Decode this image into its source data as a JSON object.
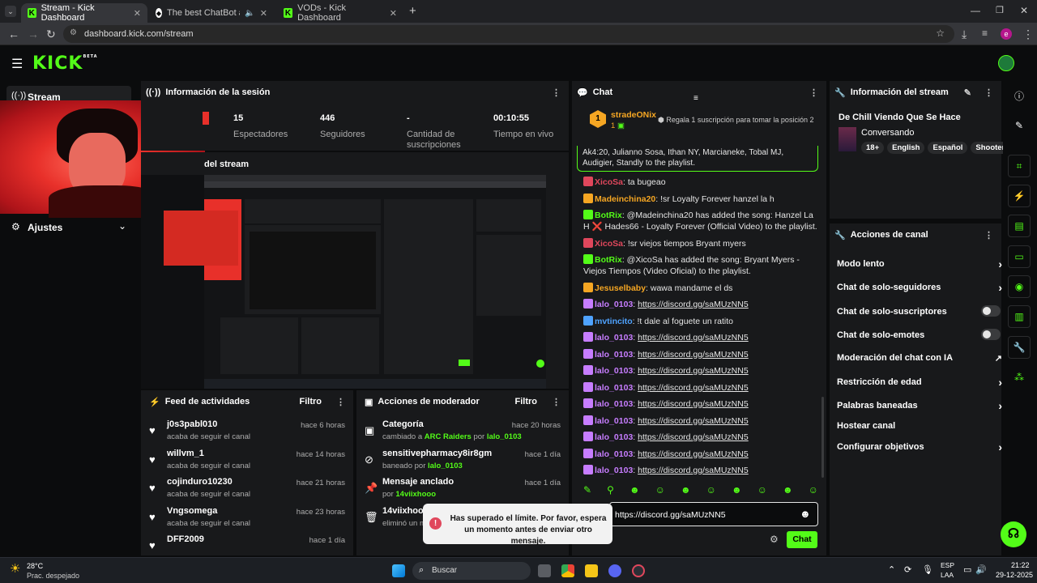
{
  "browser": {
    "tabs": [
      {
        "label": "Stream - Kick Dashboard"
      },
      {
        "label": "The best ChatBot and Widg"
      },
      {
        "label": "VODs - Kick Dashboard"
      }
    ],
    "url": "dashboard.kick.com/stream"
  },
  "header": {
    "logo": "KICK",
    "logo_sup": "BETA"
  },
  "sidebar": {
    "stream_label": "Stream",
    "settings_label": "Ajustes"
  },
  "session": {
    "title": "Información de la sesión",
    "stats": [
      {
        "value": "15",
        "label": "Espectadores"
      },
      {
        "value": "446",
        "label": "Seguidores"
      },
      {
        "value": "-",
        "label": "Cantidad de suscripciones"
      },
      {
        "value": "00:10:55",
        "label": "Tiempo en vivo"
      }
    ]
  },
  "preview": {
    "title": "del stream"
  },
  "activity": {
    "title": "Feed de actividades",
    "filter": "Filtro",
    "items": [
      {
        "name": "j0s3pabl010",
        "sub": "acaba de seguir el canal",
        "time": "hace 6 horas"
      },
      {
        "name": "willvm_1",
        "sub": "acaba de seguir el canal",
        "time": "hace 14 horas"
      },
      {
        "name": "cojinduro10230",
        "sub": "acaba de seguir el canal",
        "time": "hace 21 horas"
      },
      {
        "name": "Vngsomega",
        "sub": "acaba de seguir el canal",
        "time": "hace 23 horas"
      },
      {
        "name": "DFF2009",
        "sub": "",
        "time": "hace 1 día"
      }
    ]
  },
  "mod": {
    "title": "Acciones de moderador",
    "filter": "Filtro",
    "items": [
      {
        "name": "Categoría",
        "sub_pre": "cambiado a ",
        "sub_hl": "ARC Raiders",
        "sub_mid": " por ",
        "sub_user": "lalo_0103",
        "time": "hace 20 horas"
      },
      {
        "name": "sensitivepharmacy8ir8gm",
        "sub_pre": "baneado por ",
        "sub_user": "lalo_0103",
        "time": "hace 1 día"
      },
      {
        "name": "Mensaje anclado",
        "sub_pre": "por ",
        "sub_user": "14viixhooo",
        "time": "hace 1 día"
      },
      {
        "name": "14viixhooo",
        "sub_pre": "eliminó un m",
        "time": ""
      }
    ]
  },
  "toast": {
    "text": "Has superado el límite. Por favor, espera un momento antes de enviar otro mensaje."
  },
  "chat": {
    "title": "Chat",
    "top_user": "stradeONix",
    "top_rank": "1",
    "top_count": "1",
    "top_note": "Regala 1 suscripción para tomar la posición 2",
    "pinned": "Ak4:20, Julianno Sosa, Ithan NY, Marcianeke, Tobal MJ, Audigier, Standly to the playlist.",
    "messages": [
      {
        "user": "XicoSa",
        "color": "#e0475c",
        "text": ": ta bugeao"
      },
      {
        "user": "Madeinchina20",
        "color": "#f5a623",
        "text": ": !sr Loyalty Forever hanzel la h"
      },
      {
        "user": "BotRix",
        "color": "#53fc18",
        "text": ": @Madeinchina20 has added the song: Hanzel La H ❌ Hades66 - Loyalty Forever (Official Video) to the playlist."
      },
      {
        "user": "XicoSa",
        "color": "#e0475c",
        "text": ": !sr viejos tiempos Bryant myers"
      },
      {
        "user": "BotRix",
        "color": "#53fc18",
        "text": ": @XicoSa has added the song: Bryant Myers - Viejos Tiempos (Video Oficial) to the playlist."
      },
      {
        "user": "Jesuselbaby",
        "color": "#f5a623",
        "text": ": wawa mandame el ds"
      },
      {
        "user": "lalo_0103",
        "color": "#c77dff",
        "link": "https://discord.gg/saMUzNN5"
      },
      {
        "user": "mvtincito",
        "color": "#4fa3ff",
        "text": ": !t dale al foguete un ratito"
      },
      {
        "user": "lalo_0103",
        "color": "#c77dff",
        "link": "https://discord.gg/saMUzNN5"
      },
      {
        "user": "lalo_0103",
        "color": "#c77dff",
        "link": "https://discord.gg/saMUzNN5"
      },
      {
        "user": "lalo_0103",
        "color": "#c77dff",
        "link": "https://discord.gg/saMUzNN5"
      },
      {
        "user": "lalo_0103",
        "color": "#c77dff",
        "link": "https://discord.gg/saMUzNN5"
      },
      {
        "user": "lalo_0103",
        "color": "#c77dff",
        "link": "https://discord.gg/saMUzNN5"
      },
      {
        "user": "lalo_0103",
        "color": "#c77dff",
        "link": "https://discord.gg/saMUzNN5"
      },
      {
        "user": "lalo_0103",
        "color": "#c77dff",
        "link": "https://discord.gg/saMUzNN5"
      },
      {
        "user": "lalo_0103",
        "color": "#c77dff",
        "link": "https://discord.gg/saMUzNN5"
      },
      {
        "user": "lalo_0103",
        "color": "#c77dff",
        "link": "https://discord.gg/saMUzNN5"
      },
      {
        "user": "lalo_0103",
        "color": "#c77dff",
        "link": "https://discord.gg/saMUzNN5"
      }
    ],
    "input_value": "https://discord.gg/saMUzNN5",
    "send_label": "Chat"
  },
  "stream_info": {
    "title": "Información del stream",
    "stream_title": "De Chill Viendo Que Se Hace",
    "category": "Conversando",
    "tags": [
      "18+",
      "English",
      "Español",
      "Shooter"
    ]
  },
  "channel_actions": {
    "title": "Acciones de canal",
    "items": [
      {
        "label": "Modo lento",
        "kind": "chevron"
      },
      {
        "label": "Chat de solo-seguidores",
        "kind": "chevron"
      },
      {
        "label": "Chat de solo-suscriptores",
        "kind": "toggle"
      },
      {
        "label": "Chat de solo-emotes",
        "kind": "toggle"
      },
      {
        "label": "Moderación del chat con IA",
        "kind": "external"
      },
      {
        "label": "Restricción de edad",
        "kind": "chevron"
      },
      {
        "label": "Palabras baneadas",
        "kind": "chevron"
      },
      {
        "label": "Hostear canal",
        "kind": "none"
      },
      {
        "label": "Configurar objetivos",
        "kind": "chevron"
      }
    ]
  },
  "taskbar": {
    "temp": "28°C",
    "weather": "Prac. despejado",
    "search": "Buscar",
    "lang": "ESP",
    "lang2": "LAA",
    "time": "21:22",
    "date": "29-12-2025"
  },
  "colors": {
    "accent": "#53fc18",
    "panel": "#18191b",
    "bg": "#0b0c0d"
  }
}
